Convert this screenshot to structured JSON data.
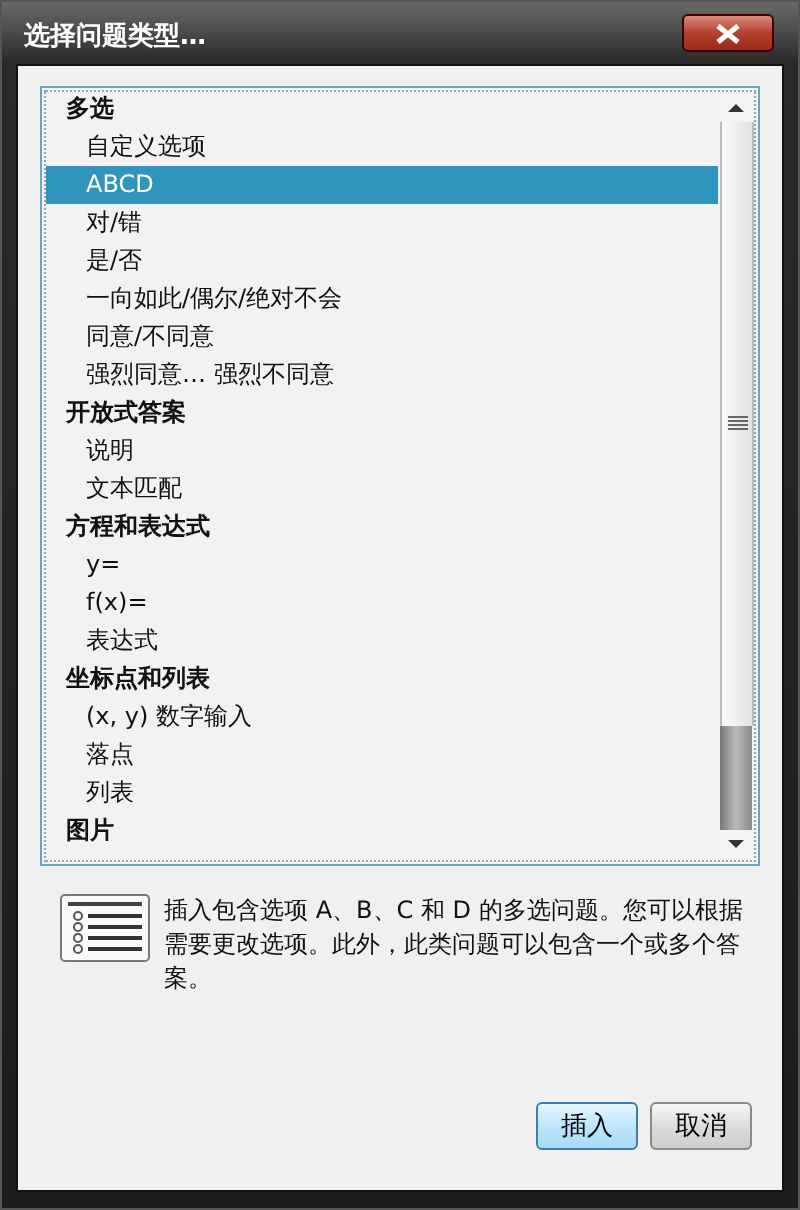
{
  "window": {
    "title": "选择问题类型…"
  },
  "list": {
    "groups": [
      {
        "label": "多选",
        "selected": false,
        "children": [
          {
            "label": "自定义选项",
            "selected": false
          },
          {
            "label": "ABCD",
            "selected": true
          },
          {
            "label": "对/错",
            "selected": false
          },
          {
            "label": "是/否",
            "selected": false
          },
          {
            "label": "一向如此/偶尔/绝对不会",
            "selected": false
          },
          {
            "label": "同意/不同意",
            "selected": false
          },
          {
            "label": "强烈同意… 强烈不同意",
            "selected": false
          }
        ]
      },
      {
        "label": "开放式答案",
        "selected": false,
        "children": [
          {
            "label": "说明",
            "selected": false
          },
          {
            "label": "文本匹配",
            "selected": false
          }
        ]
      },
      {
        "label": "方程和表达式",
        "selected": false,
        "children": [
          {
            "label": "y=",
            "selected": false
          },
          {
            "label": "f(x)=",
            "selected": false
          },
          {
            "label": "表达式",
            "selected": false
          }
        ]
      },
      {
        "label": "坐标点和列表",
        "selected": false,
        "children": [
          {
            "label": "(x, y) 数字输入",
            "selected": false
          },
          {
            "label": "落点",
            "selected": false
          },
          {
            "label": "列表",
            "selected": false
          }
        ]
      },
      {
        "label": "图片",
        "selected": false
      }
    ]
  },
  "description": "插入包含选项 A、B、C 和 D 的多选问题。您可以根据需要更改选项。此外，此类问题可以包含一个或多个答案。",
  "buttons": [
    {
      "label": "插入",
      "kind": "default"
    },
    {
      "label": "取消",
      "kind": "normal"
    }
  ]
}
